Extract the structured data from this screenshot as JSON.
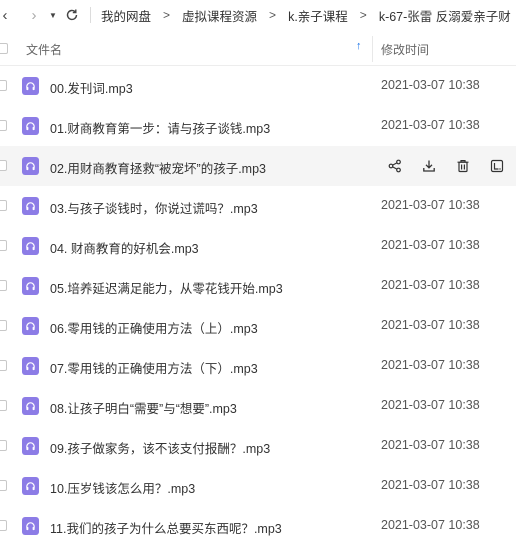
{
  "breadcrumb": [
    "我的网盘",
    "虚拟课程资源",
    "k.亲子课程",
    "k-67-张雷 反溺爱亲子财"
  ],
  "header": {
    "name_col": "文件名",
    "date_col": "修改时间"
  },
  "files": [
    {
      "name": "00.发刊词.mp3",
      "date": "2021-03-07 10:38"
    },
    {
      "name": "01.财商教育第一步：请与孩子谈钱.mp3",
      "date": "2021-03-07 10:38"
    },
    {
      "name": "02.用财商教育拯救“被宠坏”的孩子.mp3",
      "date": ""
    },
    {
      "name": "03.与孩子谈钱时，你说过谎吗？.mp3",
      "date": "2021-03-07 10:38"
    },
    {
      "name": "04. 财商教育的好机会.mp3",
      "date": "2021-03-07 10:38"
    },
    {
      "name": "05.培养延迟满足能力，从零花钱开始.mp3",
      "date": "2021-03-07 10:38"
    },
    {
      "name": "06.零用钱的正确使用方法（上）.mp3",
      "date": "2021-03-07 10:38"
    },
    {
      "name": "07.零用钱的正确使用方法（下）.mp3",
      "date": "2021-03-07 10:38"
    },
    {
      "name": "08.让孩子明白“需要”与“想要”.mp3",
      "date": "2021-03-07 10:38"
    },
    {
      "name": "09.孩子做家务，该不该支付报酬？.mp3",
      "date": "2021-03-07 10:38"
    },
    {
      "name": "10.压岁钱该怎么用？.mp3",
      "date": "2021-03-07 10:38"
    },
    {
      "name": "11.我们的孩子为什么总要买东西呢？.mp3",
      "date": "2021-03-07 10:38"
    }
  ],
  "hover_row_index": 2,
  "hover_actions": [
    "share-icon",
    "download-icon",
    "delete-icon",
    "more-icon"
  ],
  "icon_color": "#8c7ce6"
}
